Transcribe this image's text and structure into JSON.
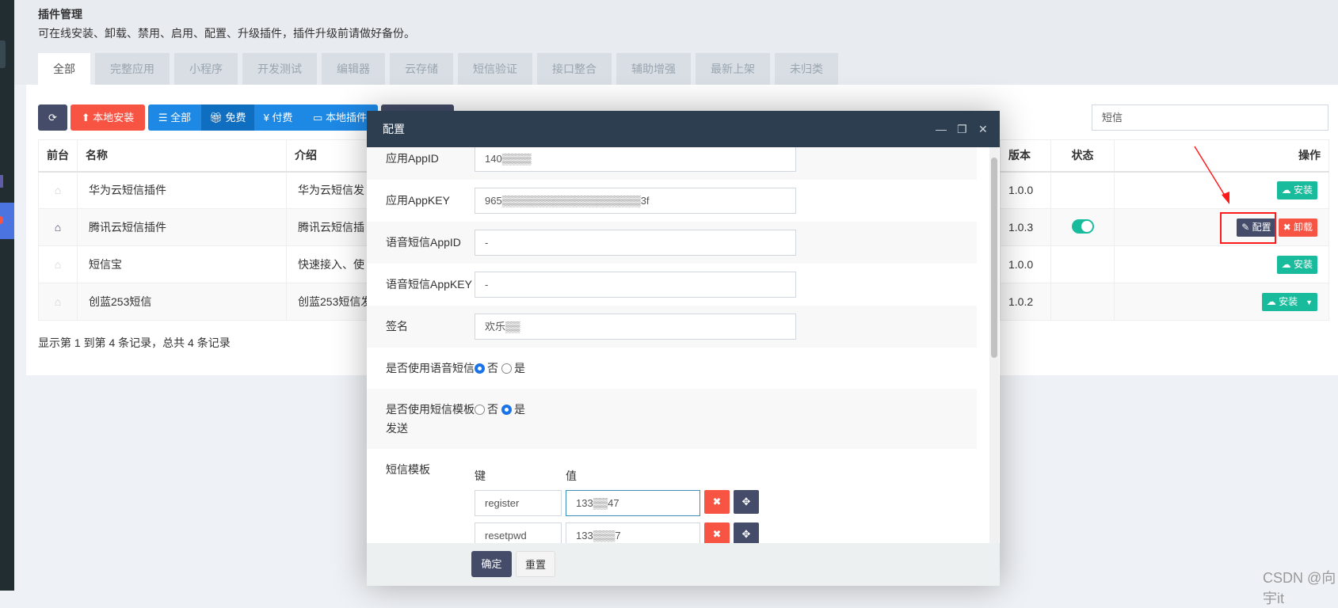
{
  "page": {
    "title": "插件管理",
    "description": "可在线安装、卸载、禁用、启用、配置、升级插件，插件升级前请做好备份。"
  },
  "tabs": [
    {
      "label": "全部",
      "active": true
    },
    {
      "label": "完整应用"
    },
    {
      "label": "小程序"
    },
    {
      "label": "开发测试"
    },
    {
      "label": "编辑器"
    },
    {
      "label": "云存储"
    },
    {
      "label": "短信验证"
    },
    {
      "label": "接口整合"
    },
    {
      "label": "辅助增强"
    },
    {
      "label": "最新上架"
    },
    {
      "label": "未归类"
    }
  ],
  "toolbar": {
    "refresh_icon": "refresh-icon",
    "local_install": "本地安装",
    "all": "全部",
    "free": "免费",
    "paid": "¥ 付费",
    "local_plugins": "本地插件",
    "search_value": "短信"
  },
  "table": {
    "headers": {
      "front": "前台",
      "name": "名称",
      "intro": "介绍",
      "version": "版本",
      "status": "状态",
      "actions": "操作"
    },
    "rows": [
      {
        "name": "华为云短信插件",
        "intro": "华为云短信发",
        "version": "1.0.0",
        "front_enabled": false,
        "installed": false,
        "install": "安装"
      },
      {
        "name": "腾讯云短信插件",
        "intro": "腾讯云短信插",
        "version": "1.0.3",
        "front_enabled": true,
        "installed": true,
        "status_on": true,
        "config": "配置",
        "uninstall": "卸载"
      },
      {
        "name": "短信宝",
        "intro": "快速接入、使",
        "version": "1.0.0",
        "front_enabled": false,
        "installed": false,
        "install": "安装"
      },
      {
        "name": "创蓝253短信",
        "intro": "创蓝253短信发",
        "version": "1.0.2",
        "front_enabled": false,
        "installed": false,
        "install": "安装",
        "has_dropdown": true
      }
    ]
  },
  "pagination": {
    "summary": "显示第 1 到第 4 条记录，总共 4 条记录"
  },
  "modal": {
    "title": "配置",
    "fields": [
      {
        "label": "应用AppID",
        "value": "140▒▒▒▒"
      },
      {
        "label": "应用AppKEY",
        "value": "965▒▒▒▒▒▒▒▒▒▒▒▒▒▒▒▒▒▒▒3f"
      },
      {
        "label": "语音短信AppID",
        "value": "-"
      },
      {
        "label": "语音短信AppKEY",
        "value": "-"
      },
      {
        "label": "签名",
        "value": "欢乐▒▒"
      }
    ],
    "voice": {
      "label": "是否使用语音短信",
      "no": "否",
      "yes": "是",
      "selected": "否"
    },
    "template_send": {
      "label": "是否使用短信模板发送",
      "no": "否",
      "yes": "是",
      "selected": "是"
    },
    "template": {
      "label": "短信模板",
      "key_header": "键",
      "value_header": "值",
      "rows": [
        {
          "key": "register",
          "value": "133▒▒47"
        },
        {
          "key": "resetpwd",
          "value": "133▒▒▒7"
        },
        {
          "key": "",
          "value": ""
        }
      ]
    },
    "confirm": "确定",
    "reset": "重置"
  },
  "watermark": "CSDN @向宇it",
  "colors": {
    "green": "#18bc9c",
    "red": "#f75444",
    "dark": "#444c69",
    "blue": "#1e88e5",
    "modal_header": "#2c3e50"
  }
}
